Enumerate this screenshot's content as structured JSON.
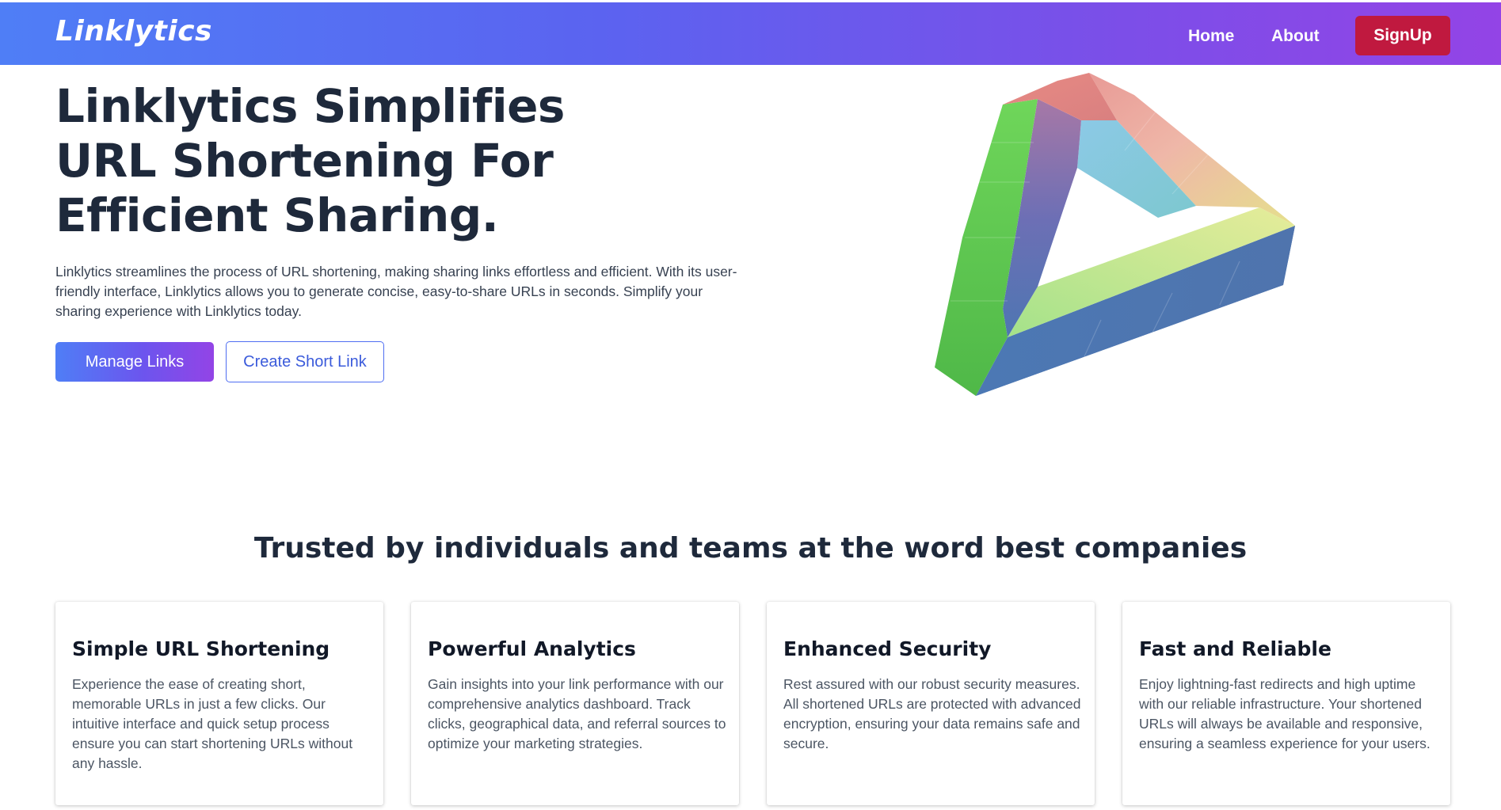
{
  "nav": {
    "logo": "Linklytics",
    "links": [
      "Home",
      "About"
    ],
    "signup": "SignUp"
  },
  "hero": {
    "title": "Linklytics Simplifies URL Shortening For Efficient Sharing.",
    "description": "Linklytics streamlines the process of URL shortening, making sharing links effortless and efficient. With its user-friendly interface, Linklytics allows you to generate concise, easy-to-share URLs in seconds. Simplify your sharing experience with Linklytics today.",
    "primary_button": "Manage Links",
    "secondary_button": "Create Short Link"
  },
  "features": {
    "heading": "Trusted by individuals and teams at the word best companies",
    "cards": [
      {
        "title": "Simple URL Shortening",
        "text": "Experience the ease of creating short, memorable URLs in just a few clicks. Our intuitive interface and quick setup process ensure you can start shortening URLs without any hassle."
      },
      {
        "title": "Powerful Analytics",
        "text": "Gain insights into your link performance with our comprehensive analytics dashboard. Track clicks, geographical data, and referral sources to optimize your marketing strategies."
      },
      {
        "title": "Enhanced Security",
        "text": "Rest assured with our robust security measures. All shortened URLs are protected with advanced encryption, ensuring your data remains safe and secure."
      },
      {
        "title": "Fast and Reliable",
        "text": "Enjoy lightning-fast redirects and high uptime with our reliable infrastructure. Your shortened URLs will always be available and responsive, ensuring a seamless experience for your users."
      }
    ]
  },
  "colors": {
    "nav_gradient_start": "#4f7ef6",
    "nav_gradient_end": "#9344e6",
    "signup_bg": "#c0193f",
    "heading_text": "#1e293b",
    "outline_button": "#3b5bdb"
  },
  "icons": {
    "hero_illustration": "penrose-triangle-illustration"
  }
}
